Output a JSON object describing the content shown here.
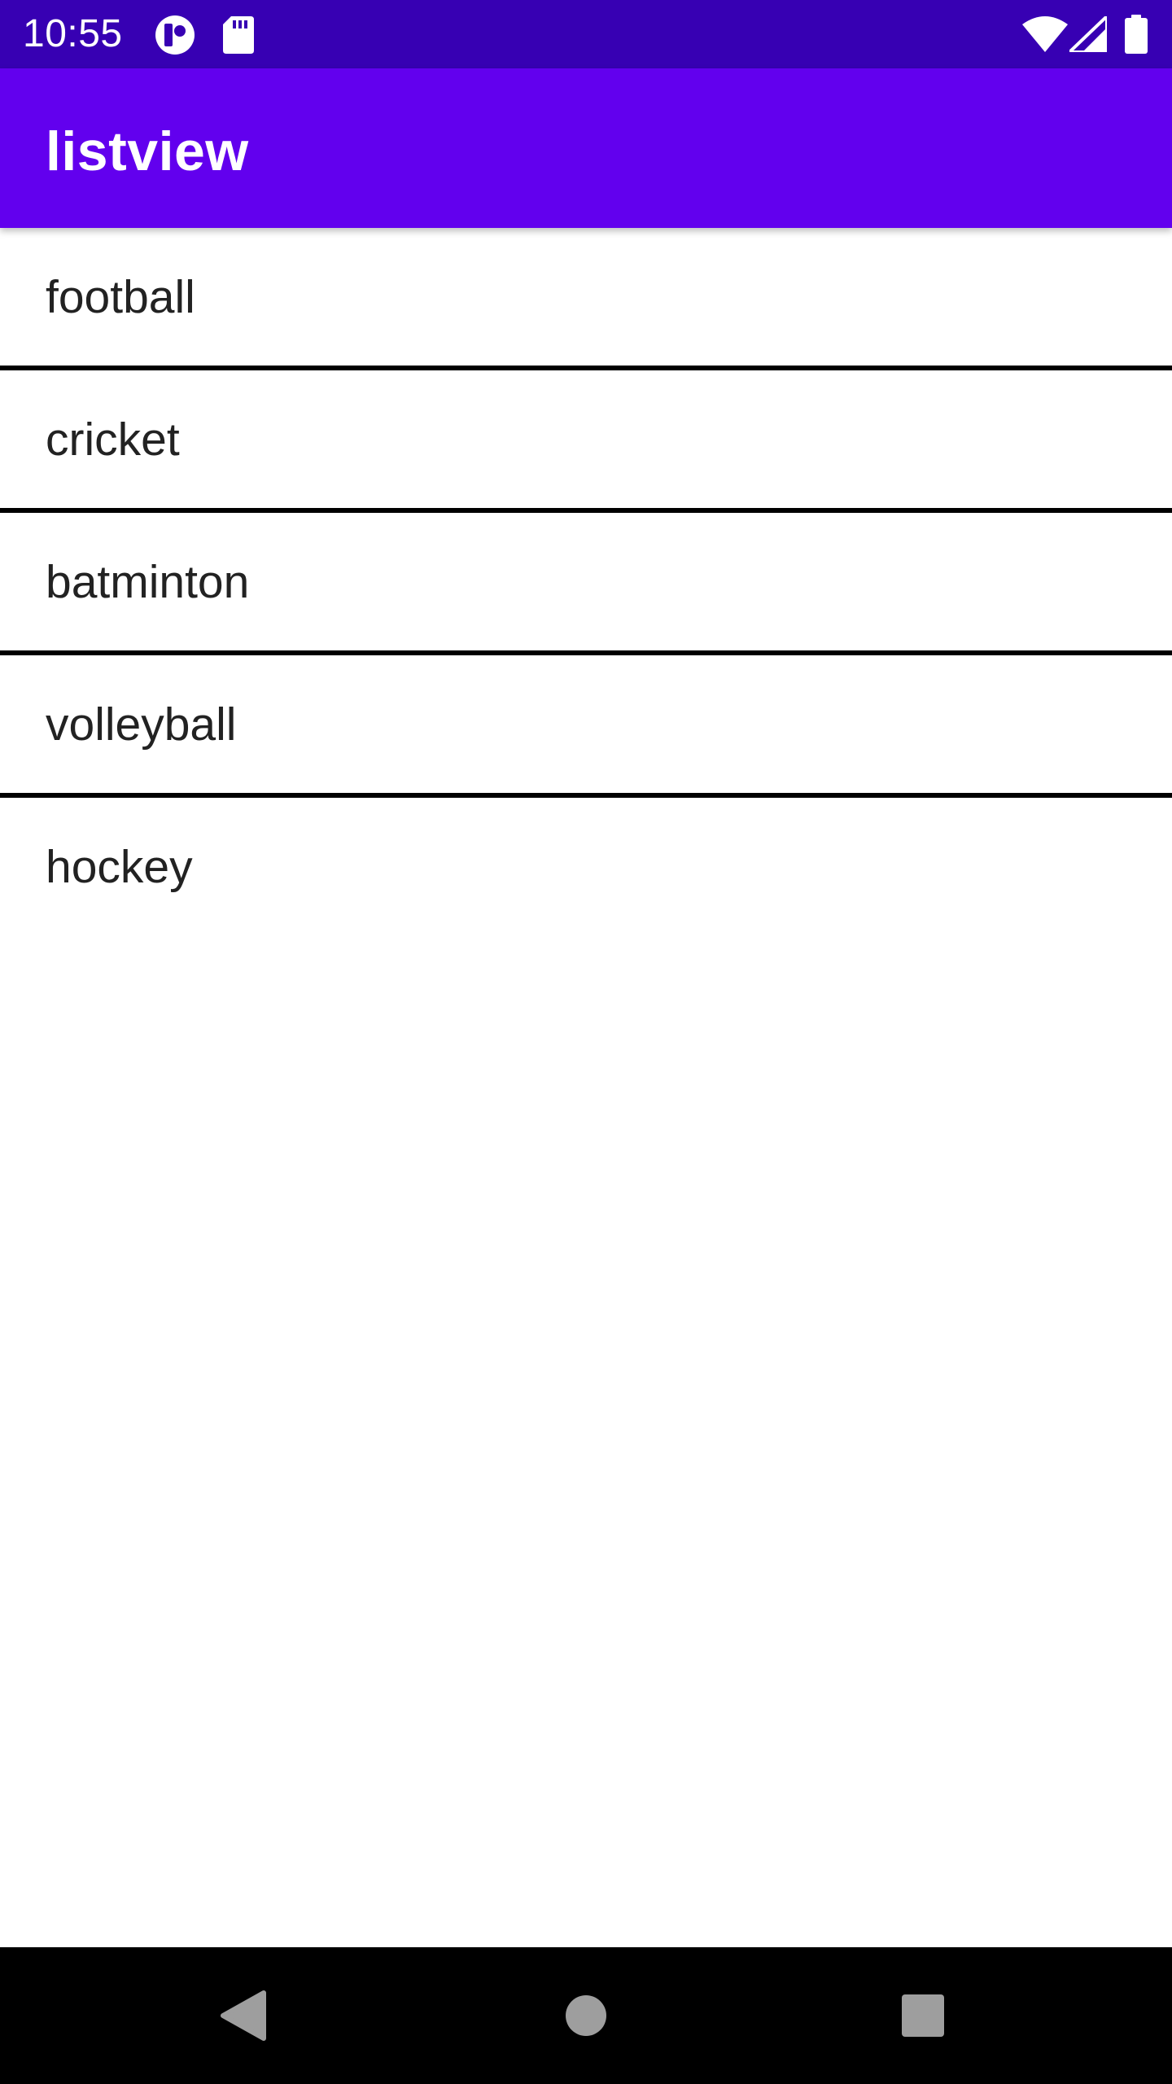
{
  "status_bar": {
    "time": "10:55",
    "background_color": "#3700b3",
    "left_icons": [
      "app-notification-icon",
      "sd-card-icon"
    ],
    "right_icons": [
      "wifi-icon",
      "cellular-signal-icon",
      "battery-icon"
    ]
  },
  "app_bar": {
    "title": "listview",
    "background_color": "#6200ee"
  },
  "list": {
    "items": [
      {
        "label": "football"
      },
      {
        "label": "cricket"
      },
      {
        "label": "batminton"
      },
      {
        "label": "volleyball"
      },
      {
        "label": "hockey"
      }
    ],
    "divider_color": "#000000"
  },
  "nav_bar": {
    "buttons": [
      "back-icon",
      "home-icon",
      "recents-icon"
    ]
  }
}
